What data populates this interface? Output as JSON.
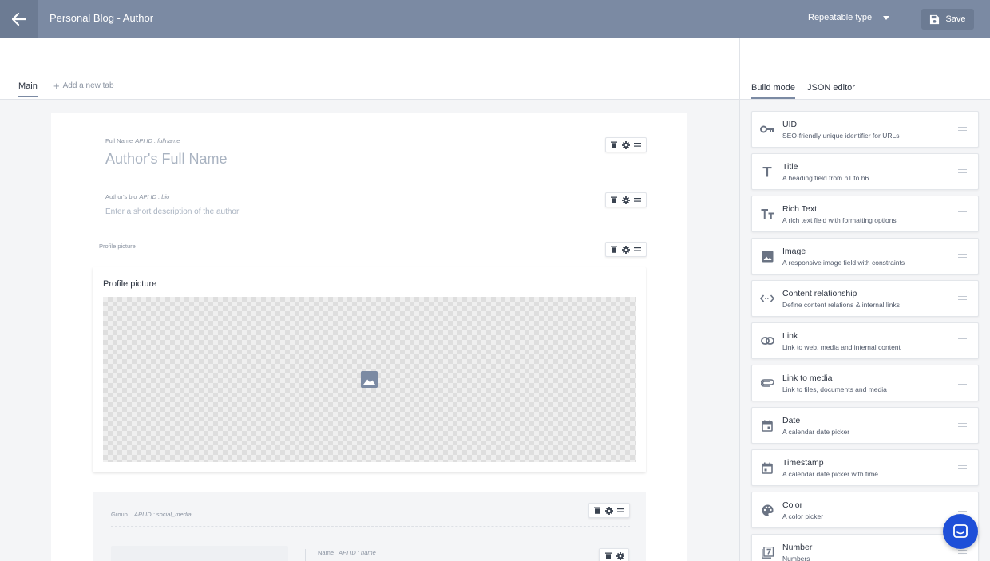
{
  "header": {
    "title": "Personal Blog - Author",
    "type_select": "Repeatable type",
    "save_label": "Save"
  },
  "tabs": {
    "main": "Main",
    "add": "Add a new tab"
  },
  "fields": {
    "fullname": {
      "label": "Full Name",
      "api": "API ID : fullname",
      "placeholder": "Author's Full Name"
    },
    "bio": {
      "label": "Author's bio",
      "api": "API ID : bio",
      "placeholder": "Enter a short description of the author"
    },
    "picture": {
      "label": "Profile picture",
      "card_title": "Profile picture"
    },
    "group": {
      "label": "Group",
      "api": "API ID : social_media",
      "inner_label": "Name",
      "inner_api": "API ID : name"
    }
  },
  "right_panel": {
    "tabs": [
      "Build mode",
      "JSON editor"
    ],
    "widgets": [
      {
        "name": "UID",
        "desc": "SEO-friendly unique identifier for URLs",
        "icon": "key-icon"
      },
      {
        "name": "Title",
        "desc": "A heading field from h1 to h6",
        "icon": "title-t-icon"
      },
      {
        "name": "Rich Text",
        "desc": "A rich text field with formatting options",
        "icon": "rich-text-icon"
      },
      {
        "name": "Image",
        "desc": "A responsive image field with constraints",
        "icon": "image-icon"
      },
      {
        "name": "Content relationship",
        "desc": "Define content relations & internal links",
        "icon": "relationship-icon"
      },
      {
        "name": "Link",
        "desc": "Link to web, media and internal content",
        "icon": "link-icon"
      },
      {
        "name": "Link to media",
        "desc": "Link to files, documents and media",
        "icon": "paperclip-icon"
      },
      {
        "name": "Date",
        "desc": "A calendar date picker",
        "icon": "calendar-icon"
      },
      {
        "name": "Timestamp",
        "desc": "A calendar date picker with time",
        "icon": "calendar-time-icon"
      },
      {
        "name": "Color",
        "desc": "A color picker",
        "icon": "palette-icon"
      },
      {
        "name": "Number",
        "desc": "Numbers",
        "icon": "number-icon"
      }
    ]
  },
  "colors": {
    "header_bg": "#7b8aa3",
    "chat_button": "#1e4fd8"
  }
}
